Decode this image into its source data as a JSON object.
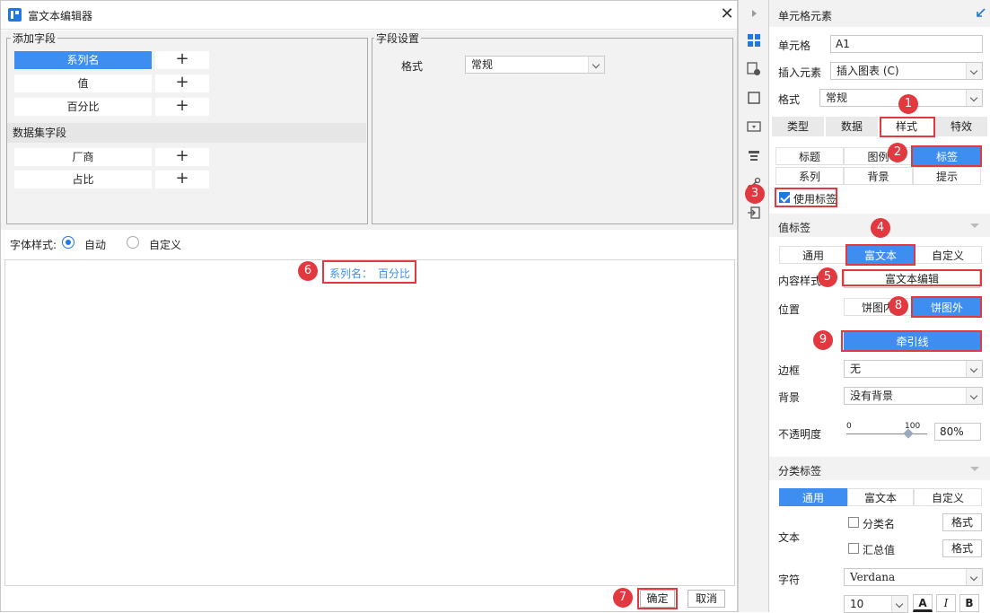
{
  "dialog": {
    "title": "富文本编辑器",
    "add_fields": {
      "legend": "添加字段",
      "fields": [
        "系列名",
        "值",
        "百分比"
      ],
      "dataset_header": "数据集字段",
      "dataset_fields": [
        "厂商",
        "占比"
      ],
      "plus_symbol": "+"
    },
    "field_settings": {
      "legend": "字段设置",
      "format_label": "格式",
      "format_value": "常规"
    },
    "font_style": {
      "label": "字体样式:",
      "options": [
        "自动",
        "自定义"
      ],
      "selected": "自动"
    },
    "editor": {
      "tokens": [
        "系列名：",
        "百分比"
      ]
    },
    "ok_label": "确定",
    "cancel_label": "取消"
  },
  "annotations": [
    "1",
    "2",
    "3",
    "4",
    "5",
    "6",
    "7",
    "8",
    "9"
  ],
  "right_panel": {
    "header": "单元格元素",
    "cell_label": "单元格",
    "cell_value": "A1",
    "insert_label": "插入元素",
    "insert_value": "插入图表 (C)",
    "format_label": "格式",
    "format_value": "常规",
    "main_tabs": [
      "类型",
      "数据",
      "样式",
      "特效"
    ],
    "style_tabs_row1": [
      "标题",
      "图例",
      "标签"
    ],
    "style_tabs_row2": [
      "系列",
      "背景",
      "提示"
    ],
    "use_label": "使用标签",
    "value_label": {
      "header": "值标签",
      "tabs": [
        "通用",
        "富文本",
        "自定义"
      ],
      "content_style_label": "内容样式",
      "rich_edit_button": "富文本编辑",
      "position_label": "位置",
      "position_options": [
        "饼图内",
        "饼图外"
      ],
      "leader_line_button": "牵引线",
      "border_label": "边框",
      "border_value": "无",
      "background_label": "背景",
      "background_value": "没有背景",
      "opacity_label": "不透明度",
      "slider_min": "0",
      "slider_max": "100",
      "opacity_value": "80%",
      "opacity_fraction": 0.8
    },
    "category_label": {
      "header": "分类标签",
      "tabs": [
        "通用",
        "富文本",
        "自定义"
      ],
      "text_label": "文本",
      "check_category_name": "分类名",
      "check_summary": "汇总值",
      "format_btn": "格式",
      "char_label": "字符",
      "font_value": "Verdana",
      "font_size": "10",
      "style_a": "A",
      "style_i": "I",
      "style_b": "B"
    }
  },
  "colors": {
    "accent": "#3d8ef0",
    "annotation_red": "#e2383f"
  }
}
